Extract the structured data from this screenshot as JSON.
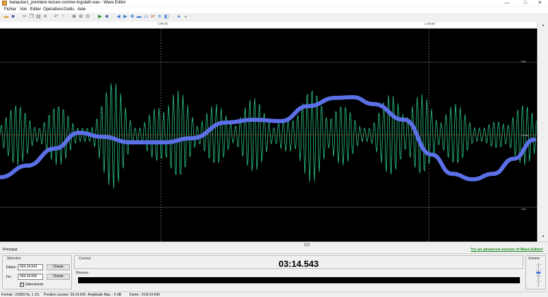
{
  "window": {
    "title": "banquise1_premiere lecture comme Argolath.wav - Wave Editor",
    "minimize_glyph": "—",
    "maximize_glyph": "□",
    "close_glyph": "✕"
  },
  "menu": [
    "Fichier",
    "Voir",
    "Editer",
    "Opérations",
    "Outils",
    "Aide"
  ],
  "timeline": {
    "ticks": [
      "1:49.40",
      "1:49.50"
    ]
  },
  "waveform": {
    "db_labels": [
      "0db",
      "-90db",
      "0db"
    ],
    "colors": {
      "background": "#000000",
      "wave": "#2ecc8a",
      "selection_overlay": "#5b6fe6",
      "center_line": "#8b2a1f",
      "grid": "#777777"
    }
  },
  "tabs": {
    "main": "Principal"
  },
  "promo_link": "Try an advanced version of Wave Editor!",
  "selection": {
    "title": "Sélection",
    "start_label": "Début :",
    "start_value": "003:14.543",
    "end_label": "Fin :",
    "end_value": "003:14.555",
    "choose_label": "Choisir",
    "select_all_label": "Sélectionné",
    "select_all_checked": true
  },
  "cursor": {
    "title": "Curseur",
    "time": "03:14.543"
  },
  "levels": {
    "title": "Niveaux"
  },
  "volume": {
    "title": "Volume"
  },
  "status": {
    "format": "Format : 22050 Hz, 1 Ch.",
    "position": "Position curseur: 03:14.543",
    "amplitude": "Amplitude Max. : 0 dB",
    "duration": "Durée : 0:03:14.543"
  }
}
